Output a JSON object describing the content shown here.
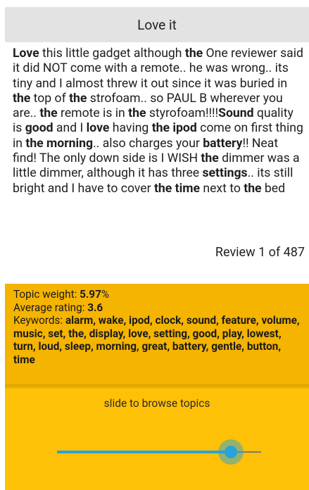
{
  "header": {
    "title": "Love it"
  },
  "review": {
    "segments": [
      {
        "t": "Love",
        "b": true
      },
      {
        "t": " this little gadget although ",
        "b": false
      },
      {
        "t": "the",
        "b": true
      },
      {
        "t": " One reviewer said it did NOT come with a remote.. he was wrong.. its tiny and I almost threw it out since it was buried in ",
        "b": false
      },
      {
        "t": "the",
        "b": true
      },
      {
        "t": " top of ",
        "b": false
      },
      {
        "t": "the",
        "b": true
      },
      {
        "t": " strofoam.. so PAUL B wherever you are.. ",
        "b": false
      },
      {
        "t": "the",
        "b": true
      },
      {
        "t": " remote is in ",
        "b": false
      },
      {
        "t": "the",
        "b": true
      },
      {
        "t": " styrofoam!!!!",
        "b": false
      },
      {
        "t": "Sound",
        "b": true
      },
      {
        "t": " quality is ",
        "b": false
      },
      {
        "t": "good",
        "b": true
      },
      {
        "t": " and I ",
        "b": false
      },
      {
        "t": "love",
        "b": true
      },
      {
        "t": " having ",
        "b": false
      },
      {
        "t": "the ipod",
        "b": true
      },
      {
        "t": " ",
        "b": false
      },
      {
        "t": "come on first thing in ",
        "b": false
      },
      {
        "t": "the morning",
        "b": true
      },
      {
        "t": ".. also charges your ",
        "b": false
      },
      {
        "t": "battery",
        "b": true
      },
      {
        "t": "!! Neat find! The only down side is I WISH ",
        "b": false
      },
      {
        "t": "the",
        "b": true
      },
      {
        "t": " dimmer was a little dimmer, although it has three ",
        "b": false
      },
      {
        "t": "settings",
        "b": true
      },
      {
        "t": ".. its still bright and I have to cover ",
        "b": false
      },
      {
        "t": "the time",
        "b": true
      },
      {
        "t": " next to ",
        "b": false
      },
      {
        "t": "the",
        "b": true
      },
      {
        "t": " bed",
        "b": false
      }
    ],
    "counter": "Review 1 of 487"
  },
  "topic": {
    "weight_label": "Topic weight: ",
    "weight_value": "5.97",
    "weight_suffix": "%",
    "rating_label": "Average rating: ",
    "rating_value": "3.6",
    "keywords_label": "Keywords: ",
    "keywords": "alarm, wake, ipod, clock, sound, feature, volume, music, set, the, display, love, setting, good, play, lowest, turn, loud, sleep, morning, great, battery, gentle, button, time"
  },
  "slider": {
    "hint": "slide to browse topics",
    "position_fraction": 0.85,
    "accent": "#2aa3d6",
    "panel_color": "#ffc107"
  }
}
